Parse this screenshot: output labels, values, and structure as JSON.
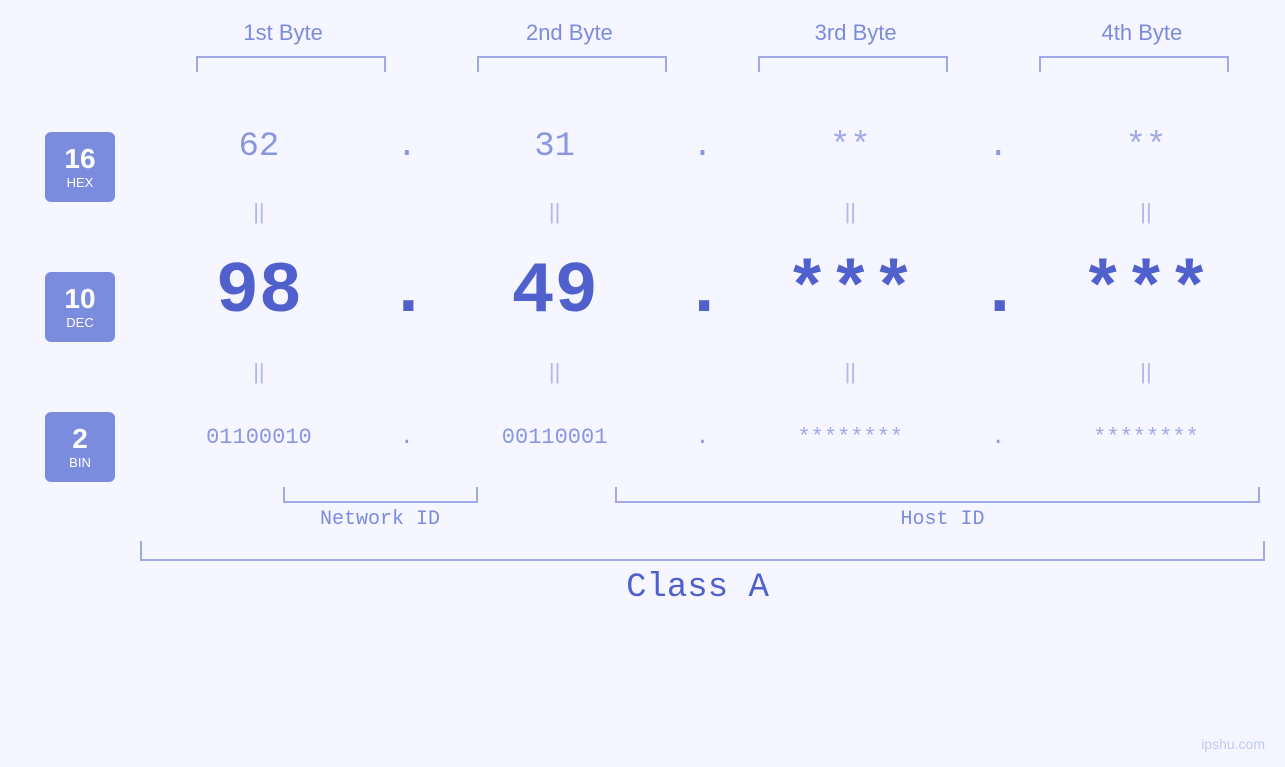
{
  "headers": {
    "byte1": "1st Byte",
    "byte2": "2nd Byte",
    "byte3": "3rd Byte",
    "byte4": "4th Byte"
  },
  "badges": {
    "hex": {
      "num": "16",
      "label": "HEX"
    },
    "dec": {
      "num": "10",
      "label": "DEC"
    },
    "bin": {
      "num": "2",
      "label": "BIN"
    }
  },
  "hex_row": {
    "b1": "62",
    "b2": "31",
    "b3": "**",
    "b4": "**",
    "dot": "."
  },
  "dec_row": {
    "b1": "98",
    "b2": "49",
    "b3": "***",
    "b4": "***",
    "dot": "."
  },
  "bin_row": {
    "b1": "01100010",
    "b2": "00110001",
    "b3": "********",
    "b4": "********",
    "dot": "."
  },
  "labels": {
    "network_id": "Network ID",
    "host_id": "Host ID",
    "class": "Class A"
  },
  "watermark": "ipshu.com"
}
